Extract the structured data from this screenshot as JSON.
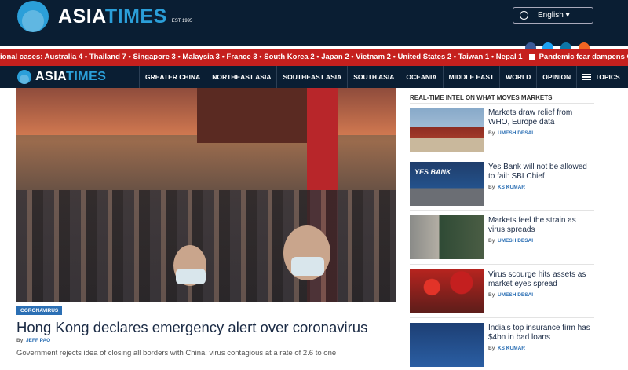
{
  "brand": {
    "name_part1": "ASIA",
    "name_part2": "TIMES",
    "est": "EST 1995"
  },
  "language_button": {
    "label": "English ▾"
  },
  "ticker": {
    "text1": "ional cases: Australia 4 • Thailand 7 • Singapore 3 • Malaysia 3 • France 3 • South Korea 2 • Japan 2 • Vietnam 2 • United States 2 • Taiwan 1 • Nepal 1",
    "text2": "Pandemic fear dampens Chinese New Year che"
  },
  "nav": {
    "items": [
      "GREATER CHINA",
      "NORTHEAST ASIA",
      "SOUTHEAST ASIA",
      "SOUTH ASIA",
      "OCEANIA",
      "MIDDLE EAST",
      "WORLD",
      "OPINION"
    ],
    "topics_label": "TOPICS"
  },
  "main_story": {
    "category": "CORONAVIRUS",
    "headline": "Hong Kong declares emergency alert over coronavirus",
    "by_prefix": "By",
    "author": "JEFF PAO",
    "summary": "Government rejects idea of closing all borders with China; virus contagious at a rate of 2.6 to one"
  },
  "sidebar": {
    "title": "REAL-TIME INTEL ON WHAT MOVES MARKETS",
    "by_prefix": "By",
    "stories": [
      {
        "headline": "Markets draw relief from WHO, Europe data",
        "author": "UMESH DESAI"
      },
      {
        "headline": "Yes Bank will not be allowed to fail: SBI Chief",
        "author": "KS KUMAR"
      },
      {
        "headline": "Markets feel the strain as virus spreads",
        "author": "UMESH DESAI"
      },
      {
        "headline": "Virus scourge hits assets as market eyes spread",
        "author": "UMESH DESAI"
      },
      {
        "headline": "India's top insurance firm has $4bn in bad loans",
        "author": "KS KUMAR"
      }
    ],
    "thumb2_label": "YES BANK"
  },
  "colors": {
    "header_bg": "#0a1e33",
    "accent_blue": "#2b9fd9",
    "ticker_red": "#c5201e",
    "link_blue": "#2b6fb4"
  }
}
